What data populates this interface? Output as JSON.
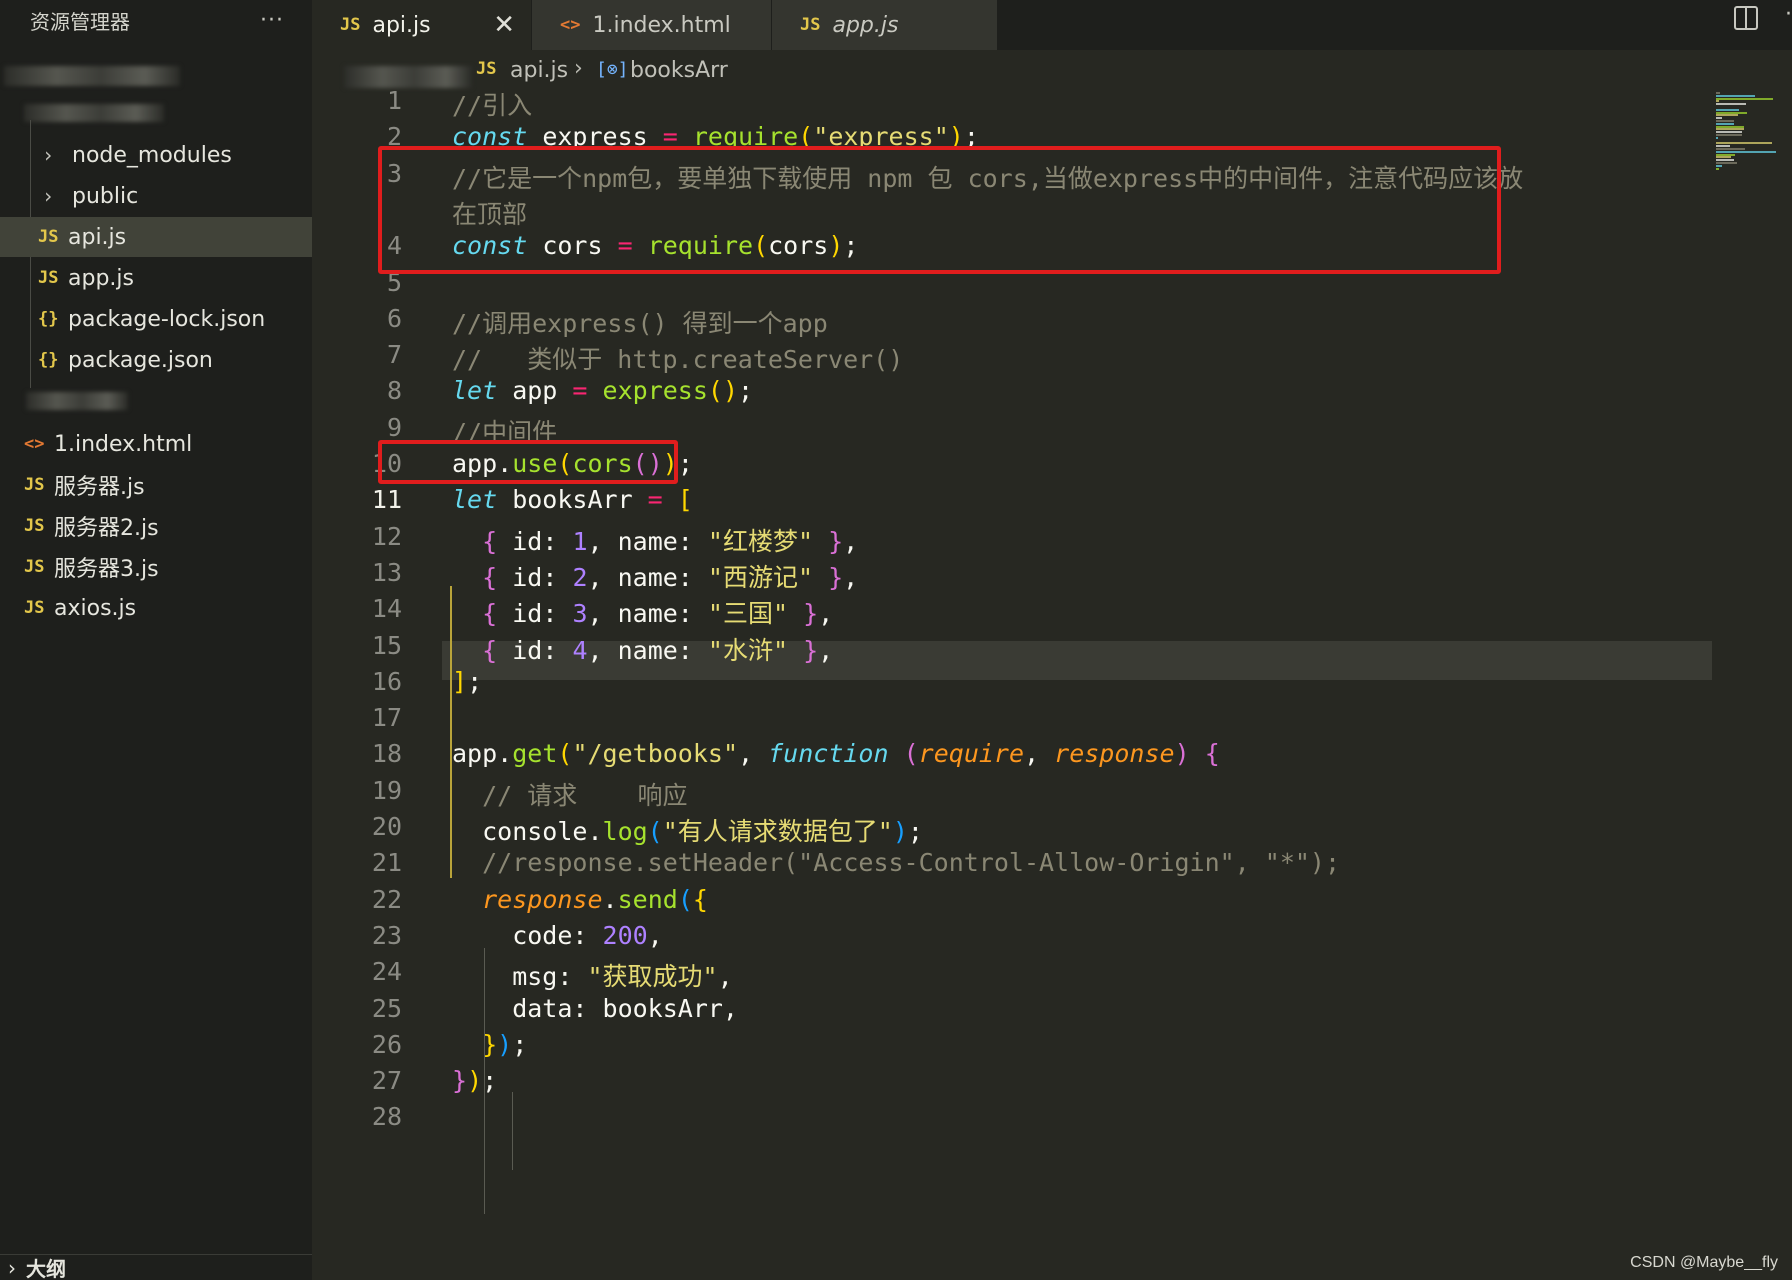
{
  "sidebar": {
    "title": "资源管理器",
    "more": "···",
    "items": [
      {
        "icon": "chevron-right-icon",
        "glyph": "›",
        "label": "node_modules"
      },
      {
        "icon": "chevron-right-icon",
        "glyph": "›",
        "label": "public"
      },
      {
        "icon": "js-file-icon",
        "glyph": "JS",
        "label": "api.js"
      },
      {
        "icon": "js-file-icon",
        "glyph": "JS",
        "label": "app.js"
      },
      {
        "icon": "json-file-icon",
        "glyph": "{}",
        "label": "package-lock.json"
      },
      {
        "icon": "json-file-icon",
        "glyph": "{}",
        "label": "package.json"
      },
      {
        "icon": "html-file-icon",
        "glyph": "<>",
        "label": "1.index.html"
      },
      {
        "icon": "js-file-icon",
        "glyph": "JS",
        "label": "服务器.js"
      },
      {
        "icon": "js-file-icon",
        "glyph": "JS",
        "label": "服务器2.js"
      },
      {
        "icon": "js-file-icon",
        "glyph": "JS",
        "label": "服务器3.js"
      },
      {
        "icon": "js-file-icon",
        "glyph": "JS",
        "label": "axios.js"
      }
    ],
    "outline": "大纲"
  },
  "tabs": [
    {
      "icon": "JS",
      "label": "api.js",
      "close": "✕",
      "active": true
    },
    {
      "icon": "<>",
      "label": "1.index.html",
      "active": false
    },
    {
      "icon": "JS",
      "label": "app.js",
      "active": false
    }
  ],
  "breadcrumb": {
    "icon": "JS",
    "file": "api.js",
    "separator": "›",
    "symbol_icon": "[⊗]",
    "symbol": "booksArr"
  },
  "editor": {
    "current_line": 11,
    "line_numbers": [
      "1",
      "2",
      "3",
      "",
      "4",
      "5",
      "6",
      "7",
      "8",
      "9",
      "10",
      "11",
      "12",
      "13",
      "14",
      "15",
      "16",
      "17",
      "18",
      "19",
      "20",
      "21",
      "22",
      "23",
      "24",
      "25",
      "26",
      "27",
      "28"
    ],
    "lines": [
      [
        [
          "com",
          "//引入"
        ]
      ],
      [
        [
          "kw",
          "const"
        ],
        [
          "p",
          " express "
        ],
        [
          "op",
          "="
        ],
        [
          "p",
          " "
        ],
        [
          "fn",
          "require"
        ],
        [
          "b1",
          "("
        ],
        [
          "str",
          "\"express\""
        ],
        [
          "b1",
          ")"
        ],
        [
          "p",
          ";"
        ]
      ],
      [
        [
          "com",
          "//它是一个npm包，要单独下载使用 npm 包 cors,当做express中的中间件，注意代码应该放"
        ]
      ],
      [
        [
          "com",
          "在顶部"
        ]
      ],
      [
        [
          "kw",
          "const"
        ],
        [
          "p",
          " cors "
        ],
        [
          "op",
          "="
        ],
        [
          "p",
          " "
        ],
        [
          "fn",
          "require"
        ],
        [
          "b1",
          "("
        ],
        [
          "p",
          "cors"
        ],
        [
          "b1",
          ")"
        ],
        [
          "p",
          ";"
        ]
      ],
      [],
      [
        [
          "com",
          "//调用express() 得到一个app"
        ]
      ],
      [
        [
          "com",
          "//   类似于 http.createServer()"
        ]
      ],
      [
        [
          "kw",
          "let"
        ],
        [
          "p",
          " app "
        ],
        [
          "op",
          "="
        ],
        [
          "p",
          " "
        ],
        [
          "fn",
          "express"
        ],
        [
          "b1",
          "()"
        ],
        [
          "p",
          ";"
        ]
      ],
      [
        [
          "com",
          "//中间件"
        ]
      ],
      [
        [
          "p",
          "app."
        ],
        [
          "fn",
          "use"
        ],
        [
          "b1",
          "("
        ],
        [
          "fn",
          "cors"
        ],
        [
          "b2",
          "()"
        ],
        [
          "b1",
          ")"
        ],
        [
          "p",
          ";"
        ]
      ],
      [
        [
          "kw",
          "let"
        ],
        [
          "p",
          " booksArr "
        ],
        [
          "op",
          "="
        ],
        [
          "p",
          " "
        ],
        [
          "b1",
          "["
        ]
      ],
      [
        [
          "p",
          "  "
        ],
        [
          "b2",
          "{"
        ],
        [
          "p",
          " id: "
        ],
        [
          "num",
          "1"
        ],
        [
          "p",
          ", name: "
        ],
        [
          "str",
          "\"红楼梦\""
        ],
        [
          "p",
          " "
        ],
        [
          "b2",
          "}"
        ],
        [
          "p",
          ","
        ]
      ],
      [
        [
          "p",
          "  "
        ],
        [
          "b2",
          "{"
        ],
        [
          "p",
          " id: "
        ],
        [
          "num",
          "2"
        ],
        [
          "p",
          ", name: "
        ],
        [
          "str",
          "\"西游记\""
        ],
        [
          "p",
          " "
        ],
        [
          "b2",
          "}"
        ],
        [
          "p",
          ","
        ]
      ],
      [
        [
          "p",
          "  "
        ],
        [
          "b2",
          "{"
        ],
        [
          "p",
          " id: "
        ],
        [
          "num",
          "3"
        ],
        [
          "p",
          ", name: "
        ],
        [
          "str",
          "\"三国\""
        ],
        [
          "p",
          " "
        ],
        [
          "b2",
          "}"
        ],
        [
          "p",
          ","
        ]
      ],
      [
        [
          "p",
          "  "
        ],
        [
          "b2",
          "{"
        ],
        [
          "p",
          " id: "
        ],
        [
          "num",
          "4"
        ],
        [
          "p",
          ", name: "
        ],
        [
          "str",
          "\"水浒\""
        ],
        [
          "p",
          " "
        ],
        [
          "b2",
          "}"
        ],
        [
          "p",
          ","
        ]
      ],
      [
        [
          "b1",
          "]"
        ],
        [
          "p",
          ";"
        ]
      ],
      [],
      [
        [
          "p",
          "app."
        ],
        [
          "fn",
          "get"
        ],
        [
          "b1",
          "("
        ],
        [
          "str",
          "\"/getbooks\""
        ],
        [
          "p",
          ", "
        ],
        [
          "kw",
          "function"
        ],
        [
          "p",
          " "
        ],
        [
          "b2",
          "("
        ],
        [
          "par",
          "require"
        ],
        [
          "p",
          ", "
        ],
        [
          "par",
          "response"
        ],
        [
          "b2",
          ")"
        ],
        [
          "p",
          " "
        ],
        [
          "b2",
          "{"
        ]
      ],
      [
        [
          "p",
          "  "
        ],
        [
          "com",
          "// 请求    响应"
        ]
      ],
      [
        [
          "p",
          "  console."
        ],
        [
          "fn",
          "log"
        ],
        [
          "b3",
          "("
        ],
        [
          "str",
          "\"有人请求数据包了\""
        ],
        [
          "b3",
          ")"
        ],
        [
          "p",
          ";"
        ]
      ],
      [
        [
          "p",
          "  "
        ],
        [
          "com",
          "//response.setHeader(\"Access-Control-Allow-Origin\", \"*\");"
        ]
      ],
      [
        [
          "p",
          "  "
        ],
        [
          "par",
          "response"
        ],
        [
          "p",
          "."
        ],
        [
          "fn",
          "send"
        ],
        [
          "b3",
          "("
        ],
        [
          "b1",
          "{"
        ]
      ],
      [
        [
          "p",
          "    code: "
        ],
        [
          "num",
          "200"
        ],
        [
          "p",
          ","
        ]
      ],
      [
        [
          "p",
          "    msg: "
        ],
        [
          "str",
          "\"获取成功\""
        ],
        [
          "p",
          ","
        ]
      ],
      [
        [
          "p",
          "    data: booksArr,"
        ]
      ],
      [
        [
          "p",
          "  "
        ],
        [
          "b1",
          "}"
        ],
        [
          "b3",
          ")"
        ],
        [
          "p",
          ";"
        ]
      ],
      [
        [
          "b2",
          "}"
        ],
        [
          "b1",
          ")"
        ],
        [
          "p",
          ";"
        ]
      ],
      []
    ]
  },
  "watermark": "CSDN @Maybe__fly",
  "colors": {
    "highlight_border": "#e01d1d",
    "background": "#272822",
    "sidebar": "#1e1f1c"
  }
}
